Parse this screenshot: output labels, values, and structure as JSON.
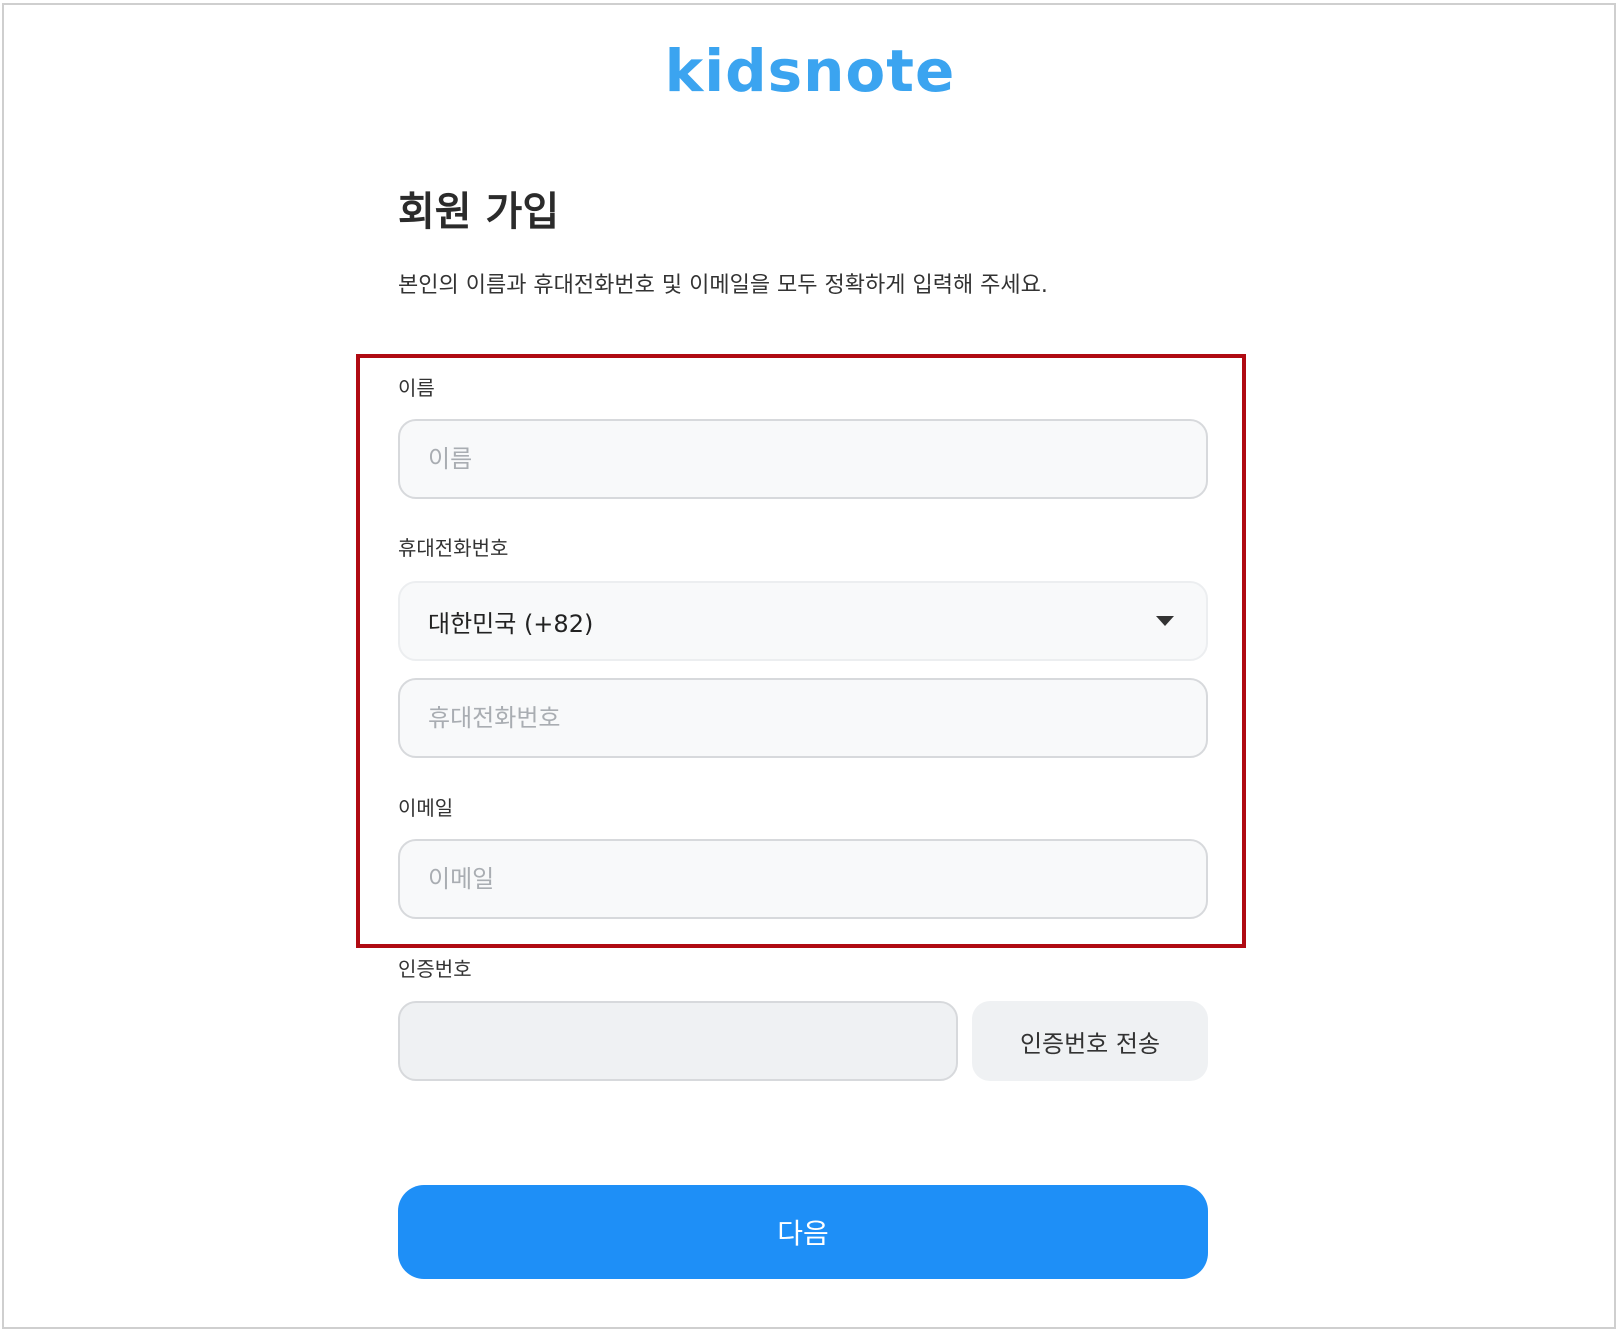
{
  "brand": {
    "logo_text": "kidsnote",
    "accent_color": "#3ba4f0",
    "button_color": "#1e8ff7",
    "highlight_color": "#b00a12"
  },
  "page": {
    "title": "회원 가입",
    "subtitle": "본인의 이름과 휴대전화번호 및 이메일을 모두 정확하게 입력해 주세요."
  },
  "form": {
    "name": {
      "label": "이름",
      "placeholder": "이름",
      "value": ""
    },
    "phone": {
      "label": "휴대전화번호",
      "country_selected": "대한민국 (+82)",
      "placeholder": "휴대전화번호",
      "value": ""
    },
    "email": {
      "label": "이메일",
      "placeholder": "이메일",
      "value": ""
    },
    "verification": {
      "label": "인증번호",
      "value": "",
      "send_button_label": "인증번호 전송"
    },
    "next_button_label": "다음"
  }
}
